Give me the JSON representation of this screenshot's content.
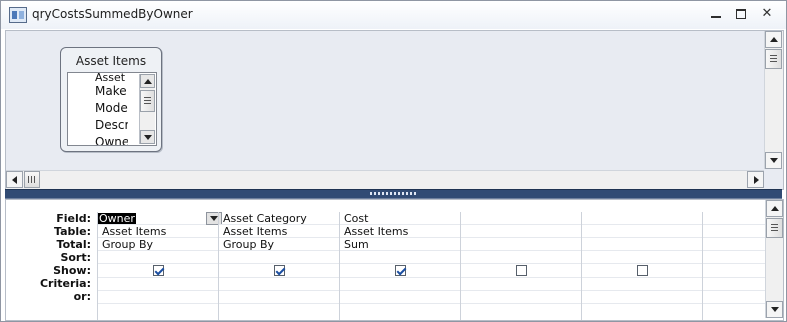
{
  "window": {
    "title": "qryCostsSummedByOwner"
  },
  "table_box": {
    "title": "Asset Items",
    "fields": [
      "Asset",
      "Make",
      "Model",
      "Descri",
      "Owne"
    ]
  },
  "grid": {
    "row_labels": [
      "Field:",
      "Table:",
      "Total:",
      "Sort:",
      "Show:",
      "Criteria:",
      "or:"
    ],
    "columns": [
      {
        "field": "Owner",
        "table": "Asset Items",
        "total": "Group By",
        "sort": "",
        "show": true,
        "criteria": "",
        "or": ""
      },
      {
        "field": "Asset Category",
        "table": "Asset Items",
        "total": "Group By",
        "sort": "",
        "show": true,
        "criteria": "",
        "or": ""
      },
      {
        "field": "Cost",
        "table": "Asset Items",
        "total": "Sum",
        "sort": "",
        "show": true,
        "criteria": "",
        "or": ""
      },
      {
        "field": "",
        "table": "",
        "total": "",
        "sort": "",
        "show": false,
        "criteria": "",
        "or": ""
      },
      {
        "field": "",
        "table": "",
        "total": "",
        "sort": "",
        "show": false,
        "criteria": "",
        "or": ""
      },
      {
        "field": "",
        "table": "",
        "total": "",
        "sort": "",
        "show": false,
        "criteria": "",
        "or": ""
      }
    ]
  }
}
